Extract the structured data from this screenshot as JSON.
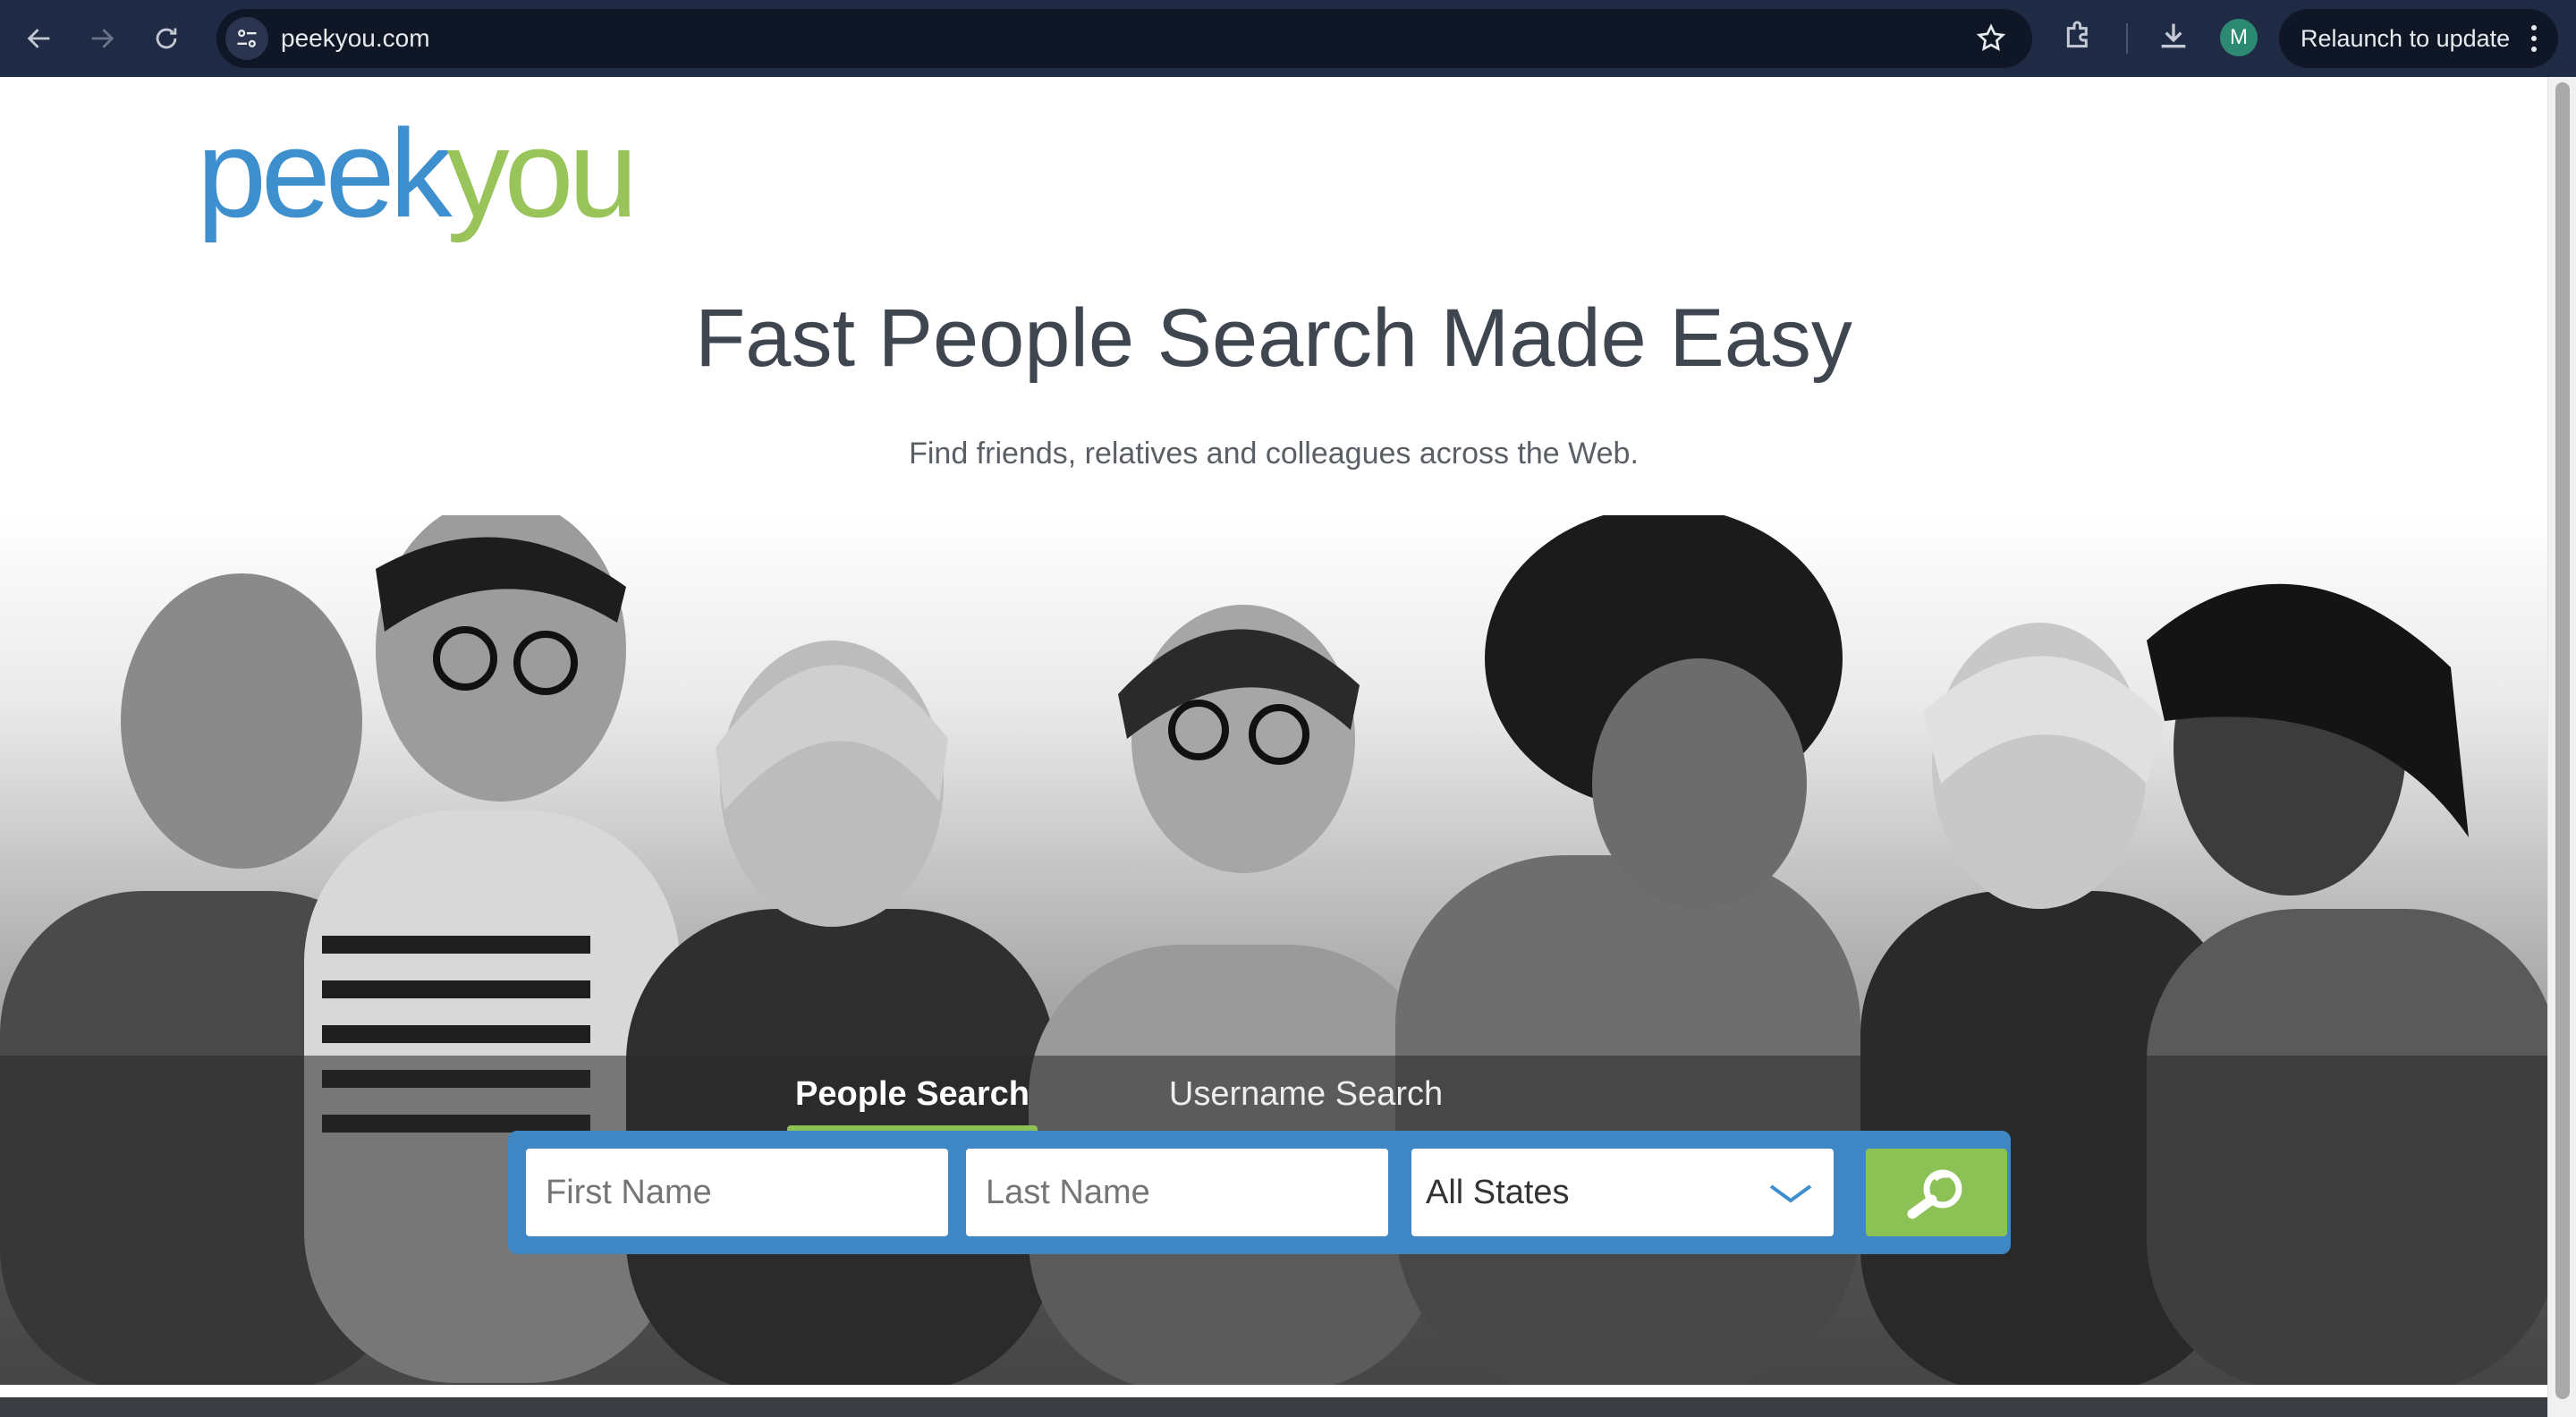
{
  "browser": {
    "url": "peekyou.com",
    "relaunch_label": "Relaunch to update",
    "profile_initial": "M",
    "icons": {
      "back": "arrow-left-icon",
      "forward": "arrow-right-icon",
      "reload": "reload-icon",
      "site_info": "tune-icon",
      "bookmark": "star-icon",
      "extensions": "puzzle-icon",
      "downloads": "download-icon",
      "menu": "kebab-icon"
    }
  },
  "page": {
    "logo": {
      "part1": "peek",
      "part2": "you"
    },
    "headline": "Fast People Search Made Easy",
    "subline": "Find friends, relatives and colleagues across the Web.",
    "tabs": [
      {
        "label": "People Search",
        "active": true
      },
      {
        "label": "Username Search",
        "active": false
      }
    ],
    "form": {
      "first_name_placeholder": "First Name",
      "last_name_placeholder": "Last Name",
      "state_value": "All States",
      "search_icon": "magnifier-icon"
    },
    "colors": {
      "brand_blue": "#3e8fce",
      "brand_green": "#98c45a",
      "search_button": "#8cc155",
      "form_bg": "#3f86c4"
    }
  }
}
